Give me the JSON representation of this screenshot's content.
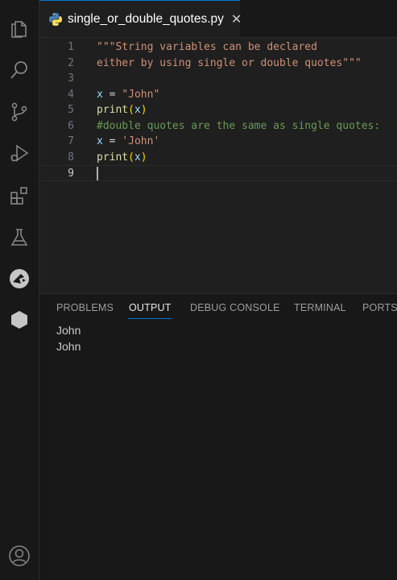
{
  "activity_bar": {
    "icons": [
      "explorer-icon",
      "search-icon",
      "source-control-icon",
      "run-debug-icon",
      "extensions-icon",
      "testing-icon",
      "remote-explorer-icon",
      "hexagon-icon",
      "account-icon"
    ]
  },
  "tab": {
    "title": "single_or_double_quotes.py",
    "close_glyph": "✕",
    "icon": "python-icon"
  },
  "editor": {
    "lines": [
      {
        "num": "1",
        "tokens": [
          {
            "t": "\"\"\"String variables can be declared",
            "c": "str"
          }
        ]
      },
      {
        "num": "2",
        "tokens": [
          {
            "t": "either by using single or double quotes\"\"\"",
            "c": "str"
          }
        ]
      },
      {
        "num": "3",
        "tokens": []
      },
      {
        "num": "4",
        "tokens": [
          {
            "t": "x",
            "c": "var"
          },
          {
            "t": " = ",
            "c": "op"
          },
          {
            "t": "\"John\"",
            "c": "str"
          }
        ]
      },
      {
        "num": "5",
        "tokens": [
          {
            "t": "print",
            "c": "fn"
          },
          {
            "t": "(",
            "c": "paren"
          },
          {
            "t": "x",
            "c": "var"
          },
          {
            "t": ")",
            "c": "paren"
          }
        ]
      },
      {
        "num": "6",
        "tokens": [
          {
            "t": "#double quotes are the same as single quotes:",
            "c": "cmt"
          }
        ]
      },
      {
        "num": "7",
        "tokens": [
          {
            "t": "x",
            "c": "var"
          },
          {
            "t": " = ",
            "c": "op"
          },
          {
            "t": "'John'",
            "c": "str"
          }
        ]
      },
      {
        "num": "8",
        "tokens": [
          {
            "t": "print",
            "c": "fn"
          },
          {
            "t": "(",
            "c": "paren"
          },
          {
            "t": "x",
            "c": "var"
          },
          {
            "t": ")",
            "c": "paren"
          }
        ]
      },
      {
        "num": "9",
        "tokens": []
      }
    ],
    "current_line": "9"
  },
  "panel": {
    "tabs": [
      "PROBLEMS",
      "OUTPUT",
      "DEBUG CONSOLE",
      "TERMINAL",
      "PORTS"
    ],
    "active_tab": "OUTPUT",
    "output_lines": [
      "John",
      "John"
    ]
  },
  "colors": {
    "accent": "#0078d4",
    "string": "#ce9178",
    "function": "#dcdcaa",
    "variable": "#9cdcfe",
    "comment": "#6a9955",
    "bracket": "#ffd700"
  }
}
